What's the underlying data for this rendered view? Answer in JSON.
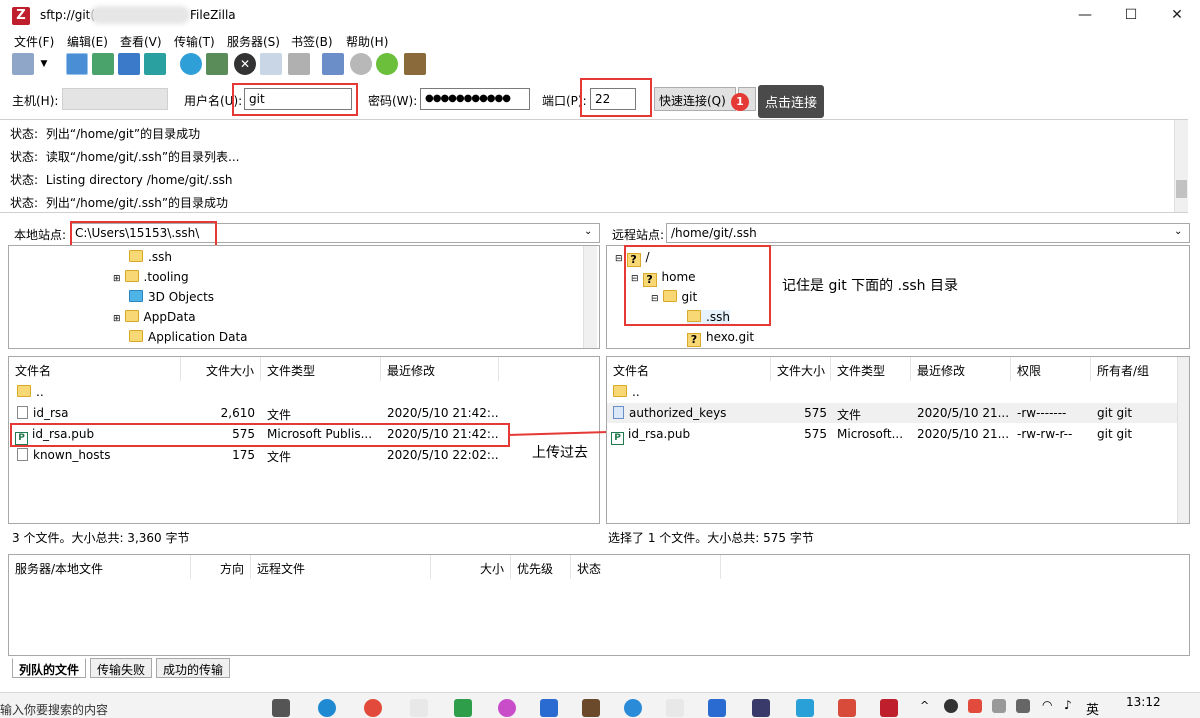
{
  "window": {
    "title_prefix": "sftp://git(",
    "title_suffix": "FileZilla",
    "app_icon": "Z"
  },
  "menu": [
    "文件(F)",
    "编辑(E)",
    "查看(V)",
    "传输(T)",
    "服务器(S)",
    "书签(B)",
    "帮助(H)"
  ],
  "quickconnect": {
    "host_label": "主机(H):",
    "host_value": "",
    "user_label": "用户名(U):",
    "user_value": "git",
    "pass_label": "密码(W):",
    "pass_value": "●●●●●●●●●●●",
    "port_label": "端口(P):",
    "port_value": "22",
    "connect_button": "快速连接(Q)",
    "tip": "点击连接",
    "badge": "1"
  },
  "status_log": [
    {
      "label": "状态:",
      "text": "列出“/home/git”的目录成功"
    },
    {
      "label": "状态:",
      "text": "读取“/home/git/.ssh”的目录列表..."
    },
    {
      "label": "状态:",
      "text": "Listing directory /home/git/.ssh"
    },
    {
      "label": "状态:",
      "text": "列出“/home/git/.ssh”的目录成功"
    }
  ],
  "local": {
    "site_label": "本地站点:",
    "path": "C:\\Users\\15153\\.ssh\\",
    "tree": [
      ".ssh",
      ".tooling",
      "3D Objects",
      "AppData",
      "Application Data"
    ],
    "columns": [
      "文件名",
      "文件大小",
      "文件类型",
      "最近修改"
    ],
    "files": [
      {
        "name": "..",
        "size": "",
        "type": "",
        "modified": ""
      },
      {
        "name": "id_rsa",
        "size": "2,610",
        "type": "文件",
        "modified": "2020/5/10 21:42:..."
      },
      {
        "name": "id_rsa.pub",
        "size": "575",
        "type": "Microsoft Publis...",
        "modified": "2020/5/10 21:42:..."
      },
      {
        "name": "known_hosts",
        "size": "175",
        "type": "文件",
        "modified": "2020/5/10 22:02:..."
      }
    ],
    "summary": "3 个文件。大小总共: 3,360 字节"
  },
  "remote": {
    "site_label": "远程站点:",
    "path": "/home/git/.ssh",
    "tree": [
      "/",
      "home",
      "git",
      ".ssh",
      "hexo.git"
    ],
    "columns": [
      "文件名",
      "文件大小",
      "文件类型",
      "最近修改",
      "权限",
      "所有者/组"
    ],
    "files": [
      {
        "name": "..",
        "size": "",
        "type": "",
        "modified": "",
        "perm": "",
        "owner": ""
      },
      {
        "name": "authorized_keys",
        "size": "575",
        "type": "文件",
        "modified": "2020/5/10 21...",
        "perm": "-rw-------",
        "owner": "git git"
      },
      {
        "name": "id_rsa.pub",
        "size": "575",
        "type": "Microsoft...",
        "modified": "2020/5/10 21...",
        "perm": "-rw-rw-r--",
        "owner": "git git"
      }
    ],
    "summary": "选择了 1 个文件。大小总共: 575 字节"
  },
  "annotations": {
    "remote_note": "记住是 git 下面的 .ssh 目录",
    "upload_note": "上传过去"
  },
  "queue": {
    "columns": [
      "服务器/本地文件",
      "方向",
      "远程文件",
      "大小",
      "优先级",
      "状态"
    ],
    "tabs": [
      "列队的文件",
      "传输失败",
      "成功的传输"
    ]
  },
  "taskbar": {
    "search": "输入你要搜索的内容",
    "time": "13:12",
    "ime": "英"
  }
}
